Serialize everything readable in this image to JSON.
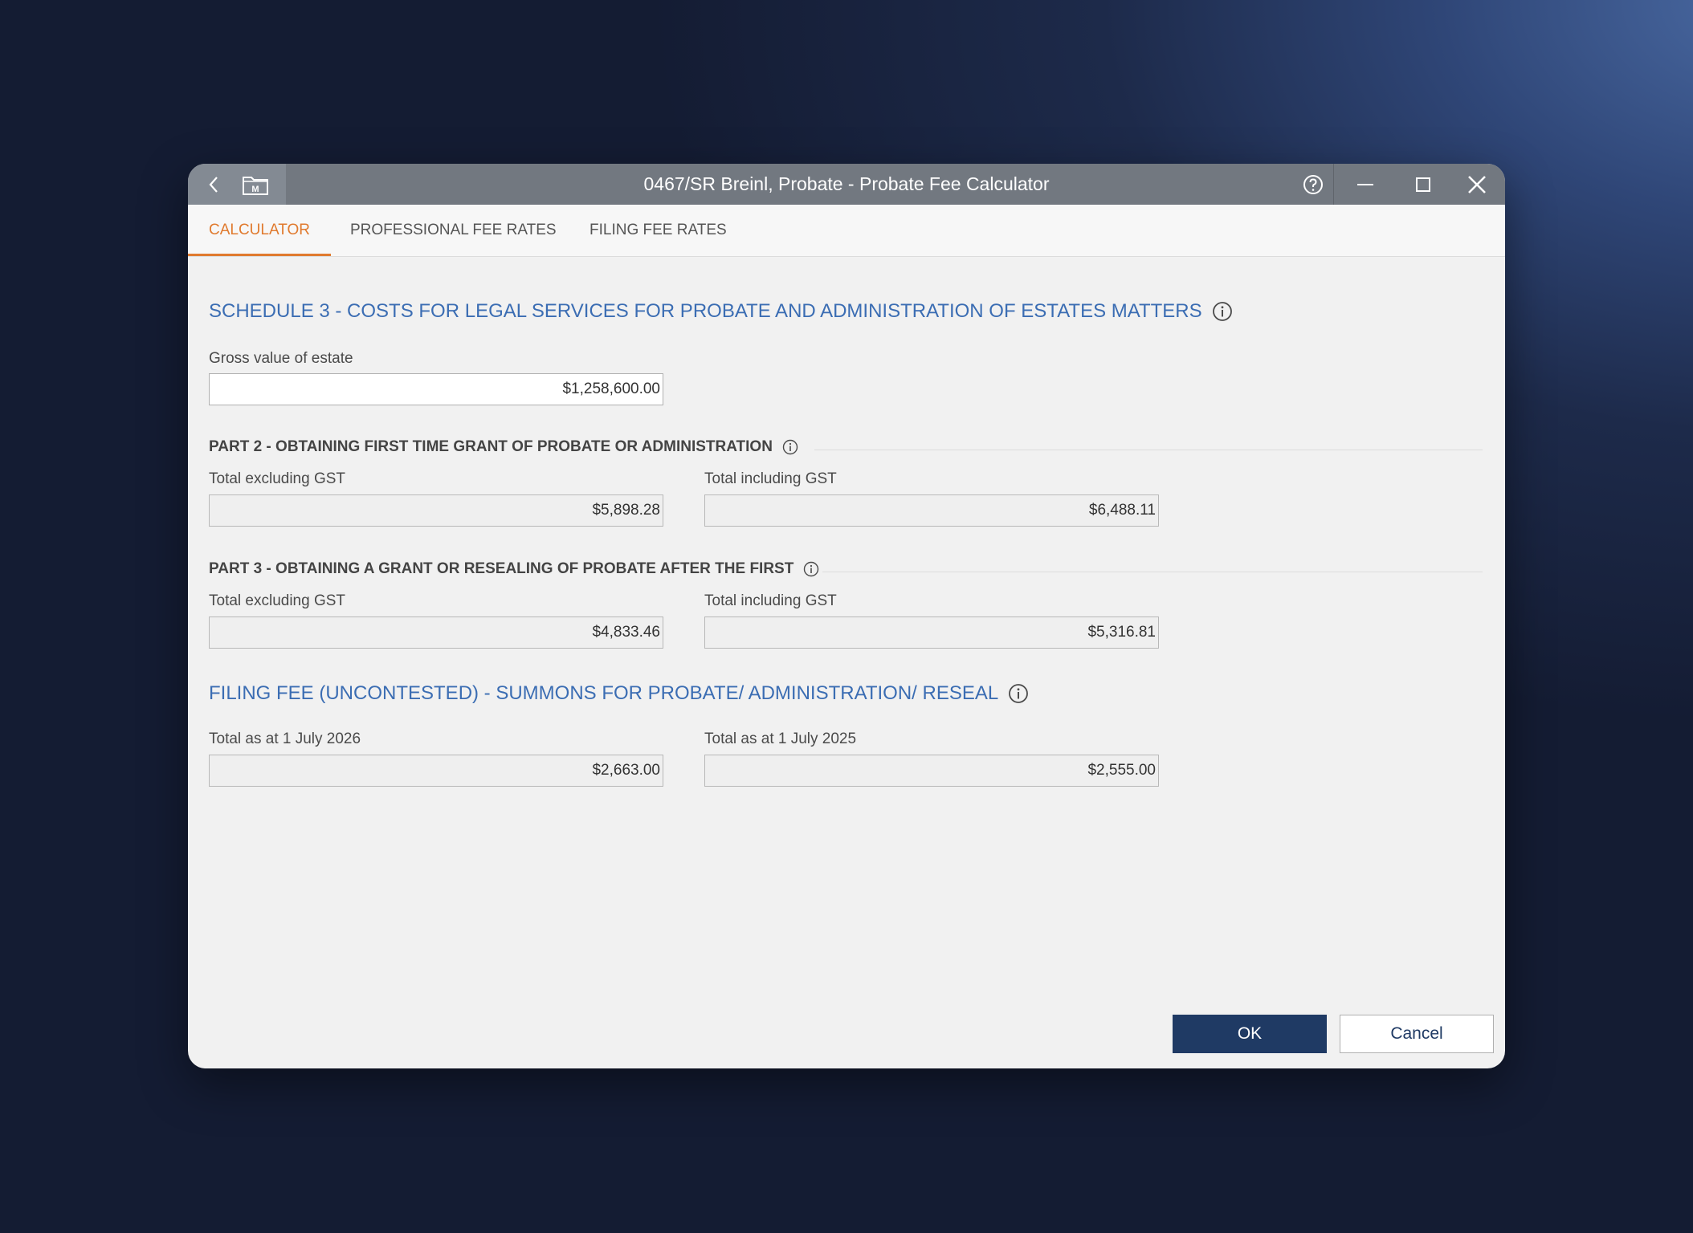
{
  "window": {
    "title": "0467/SR Breinl, Probate - Probate Fee Calculator"
  },
  "titlebar_icons": {
    "back": "chevron-left-icon",
    "matter": "matter-folder-icon",
    "help": "help-icon",
    "minimize": "minimize-icon",
    "maximize": "maximize-icon",
    "close": "close-icon"
  },
  "tabs": [
    {
      "label": "CALCULATOR",
      "active": true
    },
    {
      "label": "PROFESSIONAL FEE RATES",
      "active": false
    },
    {
      "label": "FILING FEE RATES",
      "active": false
    }
  ],
  "schedule3": {
    "title": "SCHEDULE 3 - COSTS FOR LEGAL SERVICES FOR PROBATE AND ADMINISTRATION OF ESTATES MATTERS",
    "gross_label": "Gross value of estate",
    "gross_value": "$1,258,600.00"
  },
  "part2": {
    "title": "PART 2 - OBTAINING FIRST TIME GRANT OF PROBATE OR ADMINISTRATION",
    "excl_label": "Total excluding GST",
    "excl_value": "$5,898.28",
    "incl_label": "Total including GST",
    "incl_value": "$6,488.11"
  },
  "part3": {
    "title": "PART 3 - OBTAINING A GRANT OR RESEALING OF PROBATE AFTER THE FIRST",
    "excl_label": "Total excluding GST",
    "excl_value": "$4,833.46",
    "incl_label": "Total including GST",
    "incl_value": "$5,316.81"
  },
  "filing": {
    "title": "FILING FEE (UNCONTESTED) - SUMMONS FOR PROBATE/ ADMINISTRATION/ RESEAL",
    "current_label": "Total as at 1 July 2026",
    "current_value": "$2,663.00",
    "previous_label": "Total as at 1 July 2025",
    "previous_value": "$2,555.00"
  },
  "buttons": {
    "ok": "OK",
    "cancel": "Cancel"
  },
  "colors": {
    "accent_tab": "#e07a2e",
    "section_title": "#3b6db3",
    "primary_button": "#1f3a64",
    "titlebar": "#727880"
  }
}
